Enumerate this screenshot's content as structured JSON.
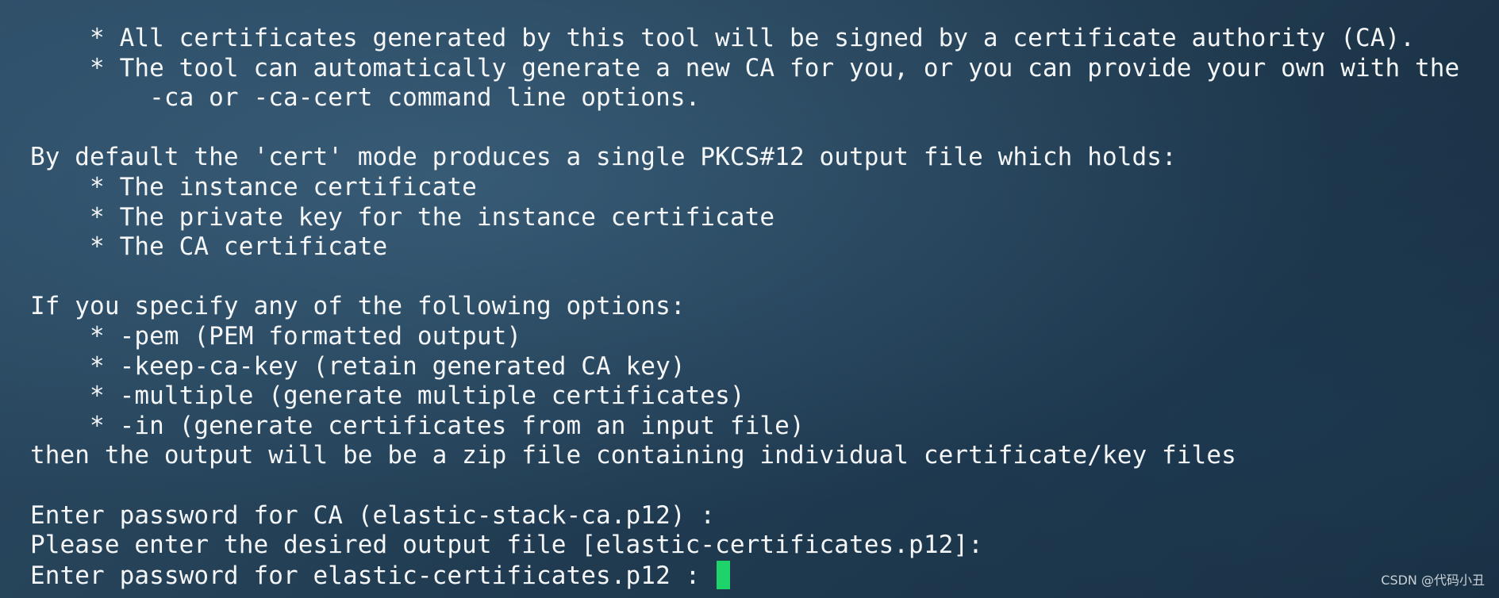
{
  "terminal": {
    "lines": [
      "    * All certificates generated by this tool will be signed by a certificate authority (CA).",
      "    * The tool can automatically generate a new CA for you, or you can provide your own with the",
      "        -ca or -ca-cert command line options.",
      "",
      "By default the 'cert' mode produces a single PKCS#12 output file which holds:",
      "    * The instance certificate",
      "    * The private key for the instance certificate",
      "    * The CA certificate",
      "",
      "If you specify any of the following options:",
      "    * -pem (PEM formatted output)",
      "    * -keep-ca-key (retain generated CA key)",
      "    * -multiple (generate multiple certificates)",
      "    * -in (generate certificates from an input file)",
      "then the output will be be a zip file containing individual certificate/key files",
      "",
      "Enter password for CA (elastic-stack-ca.p12) :",
      "Please enter the desired output file [elastic-certificates.p12]:",
      "Enter password for elastic-certificates.p12 : "
    ],
    "cursor_color": "#1fd36b",
    "text_color": "#f4f6f8"
  },
  "watermark": {
    "text": "CSDN @代码小丑"
  }
}
